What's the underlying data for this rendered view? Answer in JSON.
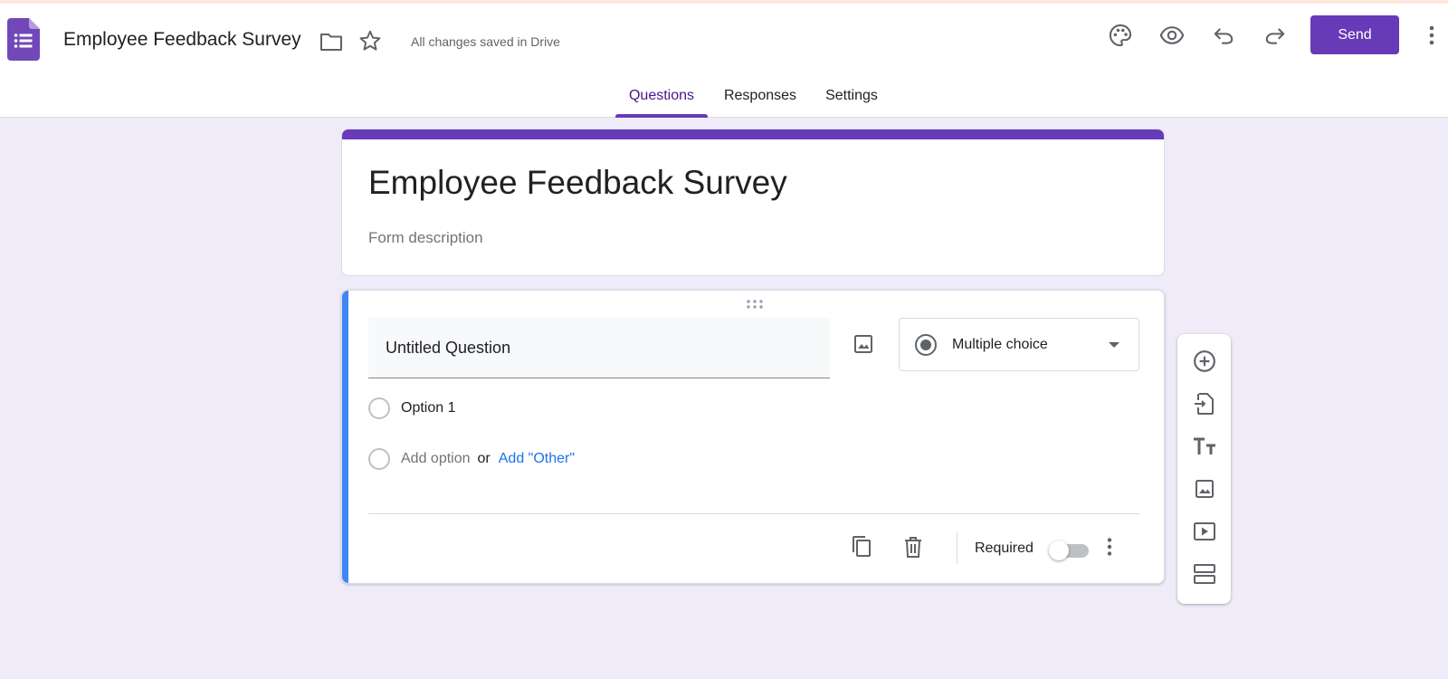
{
  "header": {
    "doc_title": "Employee Feedback Survey",
    "save_status": "All changes saved in Drive",
    "send_label": "Send",
    "icons": [
      "forms-logo-icon",
      "folder-icon",
      "star-icon",
      "palette-icon",
      "eye-icon",
      "undo-icon",
      "redo-icon",
      "more-vert-icon"
    ]
  },
  "tabs": [
    {
      "label": "Questions",
      "active": true
    },
    {
      "label": "Responses",
      "active": false
    },
    {
      "label": "Settings",
      "active": false
    }
  ],
  "form": {
    "title": "Employee Feedback Survey",
    "description_placeholder": "Form description"
  },
  "question": {
    "title": "Untitled Question",
    "type": "Multiple choice",
    "options": [
      "Option 1"
    ],
    "add_option": "Add option",
    "or": "or",
    "add_other": "Add \"Other\"",
    "required_label": "Required",
    "required": false
  },
  "toolbar": {
    "tools": [
      "add-question-icon",
      "import-questions-icon",
      "add-title-icon",
      "add-image-icon",
      "add-video-icon",
      "add-section-icon"
    ]
  },
  "colors": {
    "accent": "#673ab7",
    "background": "#f0ebf8",
    "question_accent": "#4285f4",
    "link": "#1a73e8"
  }
}
